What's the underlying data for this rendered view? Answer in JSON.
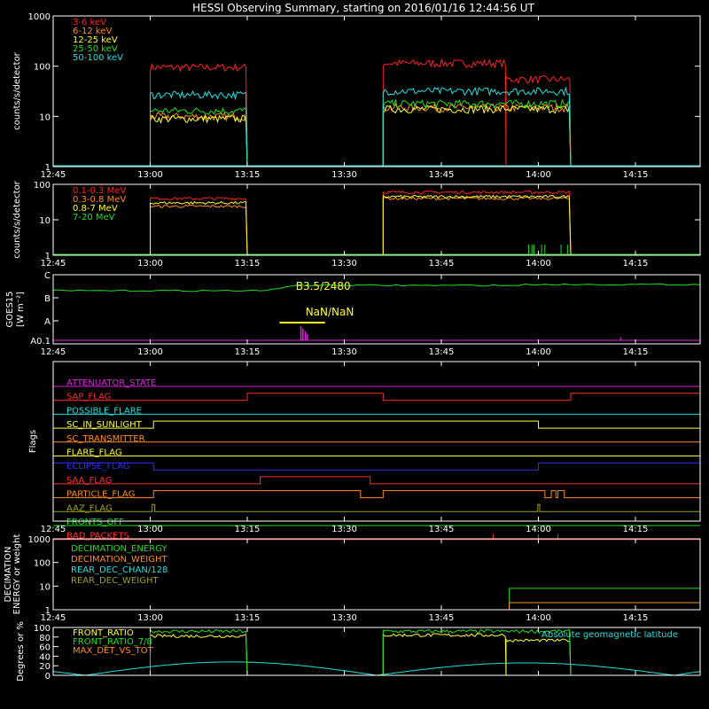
{
  "title": "HESSI Observing Summary, starting on 2016/01/16 12:44:56 UT",
  "time_axis": {
    "start_min": 0,
    "end_min": 100,
    "ticks": [
      {
        "t": 0,
        "label": "12:45"
      },
      {
        "t": 15,
        "label": "13:00"
      },
      {
        "t": 30,
        "label": "13:15"
      },
      {
        "t": 45,
        "label": "13:30"
      },
      {
        "t": 60,
        "label": "13:45"
      },
      {
        "t": 75,
        "label": "14:00"
      },
      {
        "t": 90,
        "label": "14:15"
      }
    ]
  },
  "chart_data": [
    {
      "id": "rates-low",
      "type": "line",
      "scale": "log",
      "ylim": [
        1,
        1000
      ],
      "ylabel": "counts/s/detector",
      "yticks": [
        {
          "v": 1,
          "label": "1"
        },
        {
          "v": 10,
          "label": "10"
        },
        {
          "v": 100,
          "label": "100"
        },
        {
          "v": 1000,
          "label": "1000"
        }
      ],
      "intervals": [
        [
          15,
          30
        ],
        [
          51,
          80
        ]
      ],
      "series": [
        {
          "name": "3-6 keV",
          "color": "#ff2020",
          "levels": [
            [
              15,
              30,
              95
            ],
            [
              51,
              70,
              115
            ],
            [
              70,
              80,
              55
            ]
          ]
        },
        {
          "name": "6-12 keV",
          "color": "#ff8c20",
          "levels": [
            [
              15,
              30,
              10
            ],
            [
              51,
              80,
              15
            ]
          ]
        },
        {
          "name": "12-25 keV",
          "color": "#ffff30",
          "levels": [
            [
              15,
              30,
              9
            ],
            [
              51,
              80,
              14
            ]
          ]
        },
        {
          "name": "25-50 keV",
          "color": "#20e020",
          "levels": [
            [
              15,
              30,
              13
            ],
            [
              51,
              80,
              18
            ]
          ]
        },
        {
          "name": "50-100 keV",
          "color": "#20e0e0",
          "levels": [
            [
              15,
              30,
              27
            ],
            [
              51,
              80,
              32
            ]
          ]
        }
      ]
    },
    {
      "id": "rates-high",
      "type": "line",
      "scale": "log",
      "ylim": [
        1,
        100
      ],
      "ylabel": "counts/s/detector",
      "yticks": [
        {
          "v": 1,
          "label": "1"
        },
        {
          "v": 10,
          "label": "10"
        },
        {
          "v": 100,
          "label": "100"
        }
      ],
      "intervals": [
        [
          15,
          30
        ],
        [
          51,
          80
        ]
      ],
      "series": [
        {
          "name": "0.1-0.3 MeV",
          "color": "#ff2020",
          "levels": [
            [
              15,
              30,
              40
            ],
            [
              51,
              80,
              60
            ]
          ]
        },
        {
          "name": "0.3-0.8 MeV",
          "color": "#ff8c20",
          "levels": [
            [
              15,
              30,
              24
            ],
            [
              51,
              80,
              40
            ]
          ]
        },
        {
          "name": "0.8-7 MeV",
          "color": "#ffff30",
          "levels": [
            [
              15,
              30,
              30
            ],
            [
              51,
              80,
              45
            ]
          ]
        },
        {
          "name": "7-20 MeV",
          "color": "#20e020",
          "levels": []
        }
      ],
      "green_spikes": [
        73.5,
        74,
        74.3,
        75.5,
        76,
        78.5,
        79.5
      ]
    },
    {
      "id": "goes",
      "type": "line",
      "ylabel": "GOES15",
      "ylabel2": "[W m⁻²]",
      "yticks": [
        "C",
        "B",
        "A",
        "A0.1"
      ],
      "annotations": [
        "B3.5/2480",
        "NaN/NaN"
      ],
      "flux_level": 0.65
    },
    {
      "id": "flags",
      "type": "table",
      "ylabel": "Flags",
      "rows": [
        {
          "name": "ATTENUATOR_STATE",
          "color": "#e020e0",
          "steps": []
        },
        {
          "name": "SAP_FLAG",
          "color": "#ff3030",
          "steps": [
            [
              0,
              0
            ],
            [
              30,
              1
            ],
            [
              51,
              0
            ],
            [
              80,
              1
            ]
          ]
        },
        {
          "name": "POSSIBLE_FLARE",
          "color": "#20e0e0",
          "steps": []
        },
        {
          "name": "SC_IN_SUNLIGHT",
          "color": "#ffff30",
          "steps": [
            [
              0,
              0
            ],
            [
              15.5,
              1
            ],
            [
              75,
              0
            ]
          ]
        },
        {
          "name": "SC_TRANSMITTER",
          "color": "#ff8c20",
          "steps": []
        },
        {
          "name": "FLARE_FLAG",
          "color": "#ffff30",
          "steps": []
        },
        {
          "name": "ECLIPSE_FLAG",
          "color": "#3030ff",
          "steps": [
            [
              0,
              1
            ],
            [
              15.5,
              0
            ],
            [
              75,
              1
            ]
          ]
        },
        {
          "name": "SAA_FLAG",
          "color": "#ff3030",
          "steps": [
            [
              0,
              0
            ],
            [
              32,
              1
            ],
            [
              49,
              0
            ]
          ]
        },
        {
          "name": "PARTICLE_FLAG",
          "color": "#ff8c20",
          "steps": [
            [
              0,
              0
            ],
            [
              15.5,
              1
            ],
            [
              47.5,
              0
            ],
            [
              51,
              1
            ],
            [
              76,
              0
            ],
            [
              77,
              1
            ],
            [
              77.7,
              0
            ],
            [
              78,
              1
            ],
            [
              79,
              0
            ]
          ]
        },
        {
          "name": "AAZ_FLAG",
          "color": "#a0a020",
          "steps": [
            [
              0,
              0
            ],
            [
              15.3,
              1
            ],
            [
              15.7,
              0
            ],
            [
              74.9,
              1
            ],
            [
              75.2,
              0
            ]
          ]
        },
        {
          "name": "FRONTS_OFF",
          "color": "#20e020",
          "steps": []
        },
        {
          "name": "BAD_PACKETS",
          "color": "#ff3030",
          "steps": [],
          "spikes": [
            68,
            75,
            78
          ]
        }
      ]
    },
    {
      "id": "decimation",
      "type": "line",
      "scale": "log",
      "ylim": [
        1,
        1000
      ],
      "ylabel": "DECIMATION",
      "ylabel2": "ENERGY or weight",
      "yticks": [
        {
          "v": 1,
          "label": "1"
        },
        {
          "v": 10,
          "label": "10"
        },
        {
          "v": 100,
          "label": "100"
        },
        {
          "v": 1000,
          "label": "1000"
        }
      ],
      "series": [
        {
          "name": "DECIMATION_ENERGY",
          "color": "#20e020",
          "levels": [
            [
              70.5,
              100,
              8
            ]
          ]
        },
        {
          "name": "DECIMATION_WEIGHT",
          "color": "#ff8c20",
          "levels": [
            [
              70.5,
              100,
              2
            ]
          ]
        },
        {
          "name": "REAR_DEC_CHAN/128",
          "color": "#20e0e0",
          "levels": []
        },
        {
          "name": "REAR_DEC_WEIGHT",
          "color": "#a0a020",
          "levels": []
        }
      ]
    },
    {
      "id": "ratios",
      "type": "line",
      "ylim": [
        0,
        100
      ],
      "ylabel": "Degrees or %",
      "yticks": [
        {
          "v": 0,
          "label": "0"
        },
        {
          "v": 20,
          "label": "20"
        },
        {
          "v": 40,
          "label": "40"
        },
        {
          "v": 60,
          "label": "60"
        },
        {
          "v": 80,
          "label": "80"
        },
        {
          "v": 100,
          "label": "100"
        }
      ],
      "intervals": [
        [
          15,
          30
        ],
        [
          51,
          80
        ]
      ],
      "series": [
        {
          "name": "FRONT_RATIO",
          "color": "#ffff30",
          "levels": [
            [
              15,
              30,
              82
            ],
            [
              51,
              70,
              84
            ],
            [
              70,
              80,
              73
            ]
          ]
        },
        {
          "name": "FRONT_RATIO_7/8",
          "color": "#20e020",
          "levels": [
            [
              15,
              30,
              92
            ],
            [
              51,
              80,
              92
            ]
          ]
        },
        {
          "name": "MAX_DET_VS_TOT",
          "color": "#ff8c20",
          "levels": []
        }
      ],
      "latitude": {
        "name": "Absolute geomagnetic latitude",
        "color": "#20e0e0",
        "zeros": [
          5,
          50,
          96
        ],
        "peaks": [
          {
            "t": 27,
            "v": 28
          },
          {
            "t": 73,
            "v": 26
          }
        ]
      }
    }
  ]
}
